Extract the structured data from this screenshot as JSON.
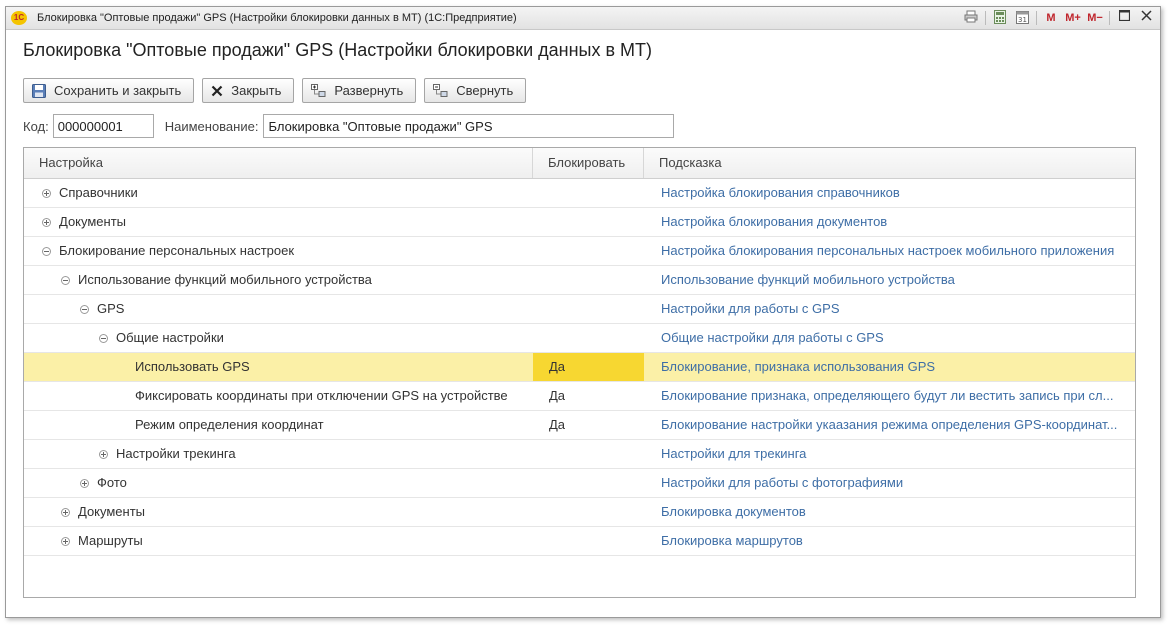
{
  "window": {
    "logo_text": "1С",
    "title": "Блокировка \"Оптовые продажи\" GPS (Настройки блокировки данных в МТ)  (1С:Предприятие)",
    "controls": [
      "M",
      "M+",
      "M−"
    ]
  },
  "page_title": "Блокировка \"Оптовые продажи\" GPS (Настройки блокировки данных в МТ)",
  "toolbar": {
    "save_close": "Сохранить и закрыть",
    "close": "Закрыть",
    "expand": "Развернуть",
    "collapse": "Свернуть"
  },
  "fields": {
    "code_label": "Код:",
    "code_value": "000000001",
    "name_label": "Наименование:",
    "name_value": "Блокировка \"Оптовые продажи\" GPS"
  },
  "grid": {
    "columns": [
      "Настройка",
      "Блокировать",
      "Подсказка"
    ],
    "rows": [
      {
        "name": "Справочники",
        "block": "",
        "hint": "Настройка блокирования справочников",
        "level": 0,
        "toggle": "plus"
      },
      {
        "name": "Документы",
        "block": "",
        "hint": "Настройка блокирования документов",
        "level": 0,
        "toggle": "plus"
      },
      {
        "name": "Блокирование персональных настроек",
        "block": "",
        "hint": "Настройка блокирования персональных настроек мобильного приложения",
        "level": 0,
        "toggle": "minus"
      },
      {
        "name": "Использование функций мобильного устройства",
        "block": "",
        "hint": "Использование функций мобильного устройства",
        "level": 1,
        "toggle": "minus"
      },
      {
        "name": "GPS",
        "block": "",
        "hint": "Настройки для работы с GPS",
        "level": 2,
        "toggle": "minus"
      },
      {
        "name": "Общие настройки",
        "block": "",
        "hint": "Общие настройки для работы с GPS",
        "level": 3,
        "toggle": "minus"
      },
      {
        "name": "Использовать GPS",
        "block": "Да",
        "hint": "Блокирование, признака использования GPS",
        "level": 4,
        "toggle": "none",
        "selected": true
      },
      {
        "name": "Фиксировать координаты при отключении GPS на устройстве",
        "block": "Да",
        "hint": "Блокирование признака, определяющего будут ли вестить запись при сл...",
        "level": 4,
        "toggle": "none"
      },
      {
        "name": "Режим определения координат",
        "block": "Да",
        "hint": "Блокирование настройки укаазания режима определения GPS-координат...",
        "level": 4,
        "toggle": "none"
      },
      {
        "name": "Настройки трекинга",
        "block": "",
        "hint": "Настройки для трекинга",
        "level": 3,
        "toggle": "plus"
      },
      {
        "name": "Фото",
        "block": "",
        "hint": "Настройки для работы с фотографиями",
        "level": 2,
        "toggle": "plus"
      },
      {
        "name": "Документы",
        "block": "",
        "hint": "Блокировка документов",
        "level": 1,
        "toggle": "plus"
      },
      {
        "name": "Маршруты",
        "block": "",
        "hint": "Блокировка маршрутов",
        "level": 1,
        "toggle": "plus"
      }
    ]
  }
}
